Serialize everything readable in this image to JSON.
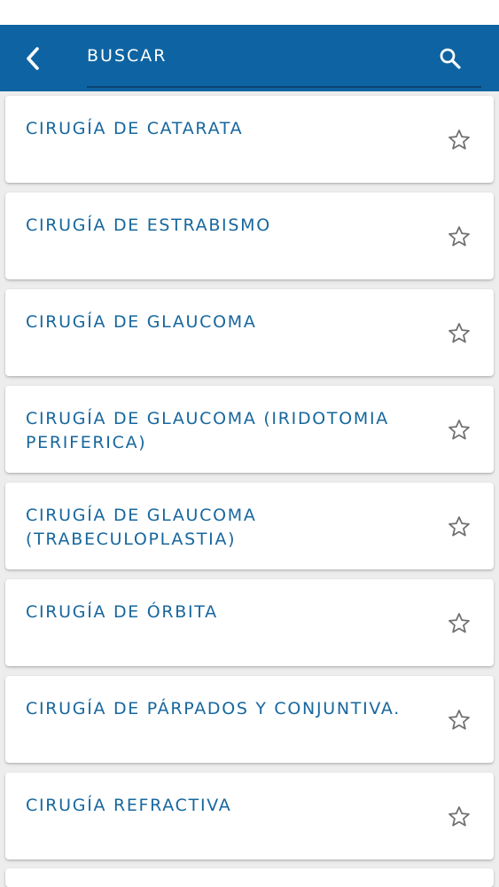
{
  "header": {
    "search_placeholder": "BUSCAR",
    "back_icon": "chevron-left-icon",
    "search_icon": "search-icon"
  },
  "colors": {
    "app_bar": "#0e64a2",
    "title_text": "#17679e",
    "background": "#ededed",
    "card": "#ffffff",
    "star_outline": "#6f6f6f"
  },
  "items": [
    {
      "title": "CIRUGÍA DE CATARATA",
      "favorite": false
    },
    {
      "title": "CIRUGÍA DE ESTRABISMO",
      "favorite": false
    },
    {
      "title": "CIRUGÍA DE GLAUCOMA",
      "favorite": false
    },
    {
      "title": "CIRUGÍA DE GLAUCOMA (IRIDOTOMIA PERIFERICA)",
      "favorite": false
    },
    {
      "title": "CIRUGÍA DE GLAUCOMA (TRABECULOPLASTIA)",
      "favorite": false
    },
    {
      "title": "CIRUGÍA DE ÓRBITA",
      "favorite": false
    },
    {
      "title": "CIRUGÍA DE PÁRPADOS Y CONJUNTIVA.",
      "favorite": false
    },
    {
      "title": "CIRUGÍA REFRACTIVA",
      "favorite": false
    }
  ]
}
